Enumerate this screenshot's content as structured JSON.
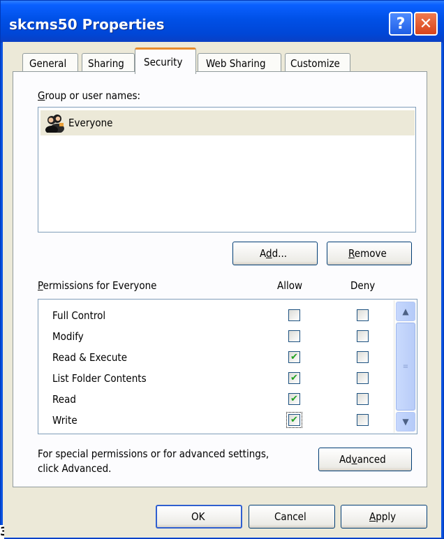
{
  "window": {
    "title": "skcms50 Properties",
    "help_glyph": "?",
    "close_glyph": "✕"
  },
  "tabs": [
    {
      "label": "General",
      "active": false
    },
    {
      "label": "Sharing",
      "active": false
    },
    {
      "label": "Security",
      "active": true
    },
    {
      "label": "Web Sharing",
      "active": false
    },
    {
      "label": "Customize",
      "active": false
    }
  ],
  "users": {
    "group_label_prefix": "G",
    "group_label_rest": "roup or user names:",
    "items": [
      {
        "name": "Everyone",
        "icon": "users-group-icon",
        "selected": true
      }
    ]
  },
  "buttons": {
    "add_pre": "A",
    "add_u": "d",
    "add_post": "d...",
    "remove_u": "R",
    "remove_post": "emove",
    "advanced_pre": "Ad",
    "advanced_u": "v",
    "advanced_post": "anced",
    "ok": "OK",
    "cancel": "Cancel",
    "apply_u": "A",
    "apply_post": "pply"
  },
  "permissions": {
    "label_u": "P",
    "label_rest": "ermissions for Everyone",
    "allow_header": "Allow",
    "deny_header": "Deny",
    "rows": [
      {
        "name": "Full Control",
        "allow": false,
        "deny": false
      },
      {
        "name": "Modify",
        "allow": false,
        "deny": false
      },
      {
        "name": "Read & Execute",
        "allow": true,
        "deny": false
      },
      {
        "name": "List Folder Contents",
        "allow": true,
        "deny": false
      },
      {
        "name": "Read",
        "allow": true,
        "deny": false
      },
      {
        "name": "Write",
        "allow": true,
        "deny": false,
        "focused": true
      }
    ]
  },
  "advanced_text": {
    "line1": "For special permissions or for advanced settings,",
    "line2": "click Advanced."
  },
  "corner_mark": "3",
  "colors": {
    "titlebar": "#0050e6",
    "dialog_bg": "#ece9d8",
    "active_tab_accent": "#e68b2c",
    "check_green": "#21a121"
  }
}
